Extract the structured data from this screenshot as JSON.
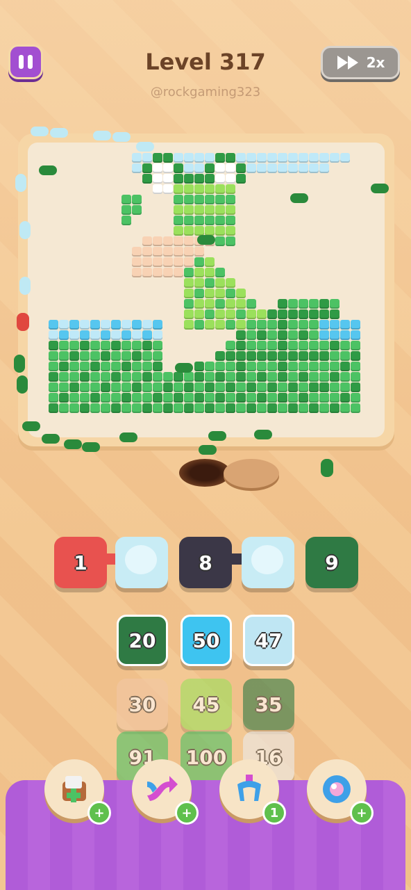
{
  "header": {
    "level_title": "Level 317",
    "handle": "@rockgaming323",
    "speed_label": "2x"
  },
  "shooters": [
    {
      "value": "1",
      "color": "#e8524f"
    },
    {
      "value": "8",
      "color": "#3b3747"
    },
    {
      "value": "9",
      "color": "#2f7a44"
    }
  ],
  "queue": [
    {
      "value": "20",
      "color": "#2f7a44"
    },
    {
      "value": "50",
      "color": "#3ec4f0"
    },
    {
      "value": "47",
      "color": "#bfe6f3"
    },
    {
      "value": "30",
      "color": "#f2c7a4"
    },
    {
      "value": "45",
      "color": "#9be05c"
    },
    {
      "value": "35",
      "color": "#2f7a44"
    },
    {
      "value": "91",
      "color": "#4cc264"
    },
    {
      "value": "100",
      "color": "#4cc264"
    },
    {
      "value": "16",
      "color": "#ececec"
    }
  ],
  "tools": [
    {
      "name": "add-box",
      "badge": "+"
    },
    {
      "name": "shuffle",
      "badge": "+"
    },
    {
      "name": "magnet-claw",
      "badge": "1"
    },
    {
      "name": "bubble",
      "badge": "+"
    }
  ],
  "colors": {
    "green_dark": "#2f9a45",
    "green_mid": "#4cc264",
    "green_light": "#9be05c",
    "sky": "#bfe9f8",
    "water": "#56c6ef",
    "peach": "#f8d2b4"
  }
}
